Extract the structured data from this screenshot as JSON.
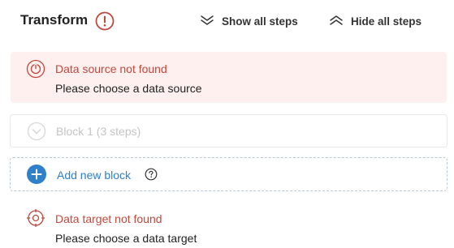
{
  "header": {
    "title": "Transform",
    "alert_icon": "exclamation-circle-icon",
    "show_all_label": "Show all steps",
    "hide_all_label": "Hide all steps",
    "show_icon": "chevrons-down-icon",
    "hide_icon": "chevrons-up-icon"
  },
  "source_error": {
    "icon": "power-circle-icon",
    "title": "Data source not found",
    "description": "Please choose a data source"
  },
  "block": {
    "icon": "chevron-down-circle-icon",
    "label": "Block 1 (3 steps)"
  },
  "add_block": {
    "icon": "plus-circle-icon",
    "label": "Add new block",
    "help_icon": "question-circle-icon"
  },
  "target_error": {
    "icon": "crosshair-icon",
    "title": "Data target not found",
    "description": "Please choose a data target"
  },
  "colors": {
    "error_red": "#c0483c",
    "error_bg": "#fdf0ef",
    "accent_blue": "#2f80c9",
    "muted_text": "#c4c4c4"
  }
}
